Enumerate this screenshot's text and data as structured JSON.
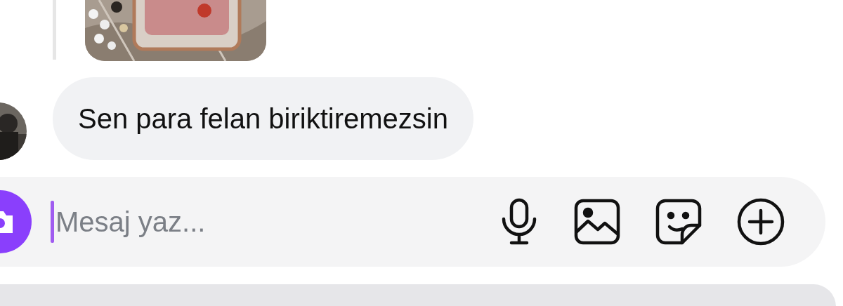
{
  "messages": [
    {
      "text": "Sen para felan biriktiremezsin"
    }
  ],
  "composer": {
    "placeholder": "Mesaj yaz...",
    "focused": true
  }
}
